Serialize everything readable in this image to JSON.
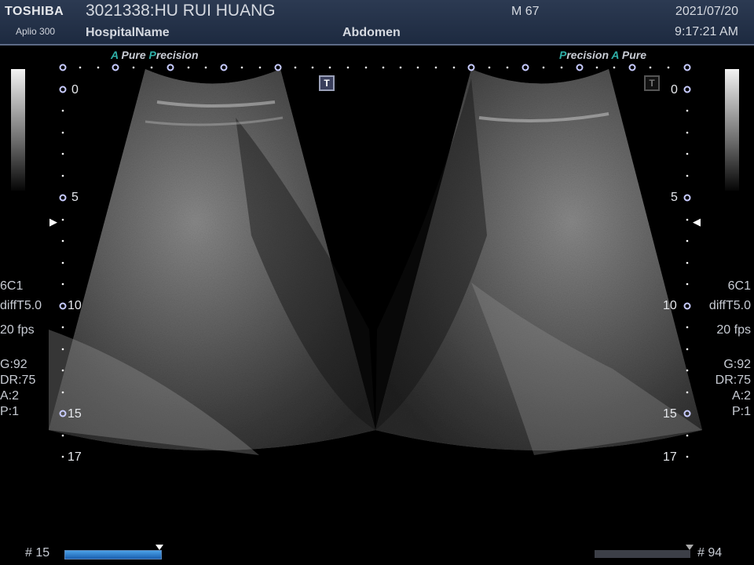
{
  "header": {
    "brand": "TOSHIBA",
    "model": "Aplio 300",
    "patient": "3021338:HU RUI HUANG",
    "hospital": "HospitalName",
    "gender_age": "M 67",
    "exam": "Abdomen",
    "date": "2021/07/20",
    "time": "9:17:21 AM"
  },
  "left_image": {
    "brand_a": "A",
    "brand_pure": "Pure",
    "brand_p": "P",
    "brand_precision": "recision",
    "depth_marks": [
      "0",
      "5",
      "10",
      "15",
      "17"
    ],
    "params": [
      "6C1",
      "diffT5.0",
      "20 fps"
    ],
    "gain": [
      "G:92",
      "DR:75",
      "A:2",
      "P:1"
    ],
    "t_label": "T"
  },
  "right_image": {
    "brand_p": "P",
    "brand_precision": "recision",
    "brand_a": "A",
    "brand_pure": "Pure",
    "depth_marks": [
      "0",
      "5",
      "10",
      "15",
      "17"
    ],
    "params": [
      "6C1",
      "diffT5.0",
      "20 fps"
    ],
    "gain": [
      "G:92",
      "DR:75",
      "A:2",
      "P:1"
    ],
    "t_label": "T"
  },
  "footer": {
    "left_frame": "# 15",
    "right_frame": "# 94"
  },
  "colors": {
    "header_bg": "#24324a",
    "brand_accent": "#2fb0a8",
    "cine_active": "#2f7fd0"
  }
}
